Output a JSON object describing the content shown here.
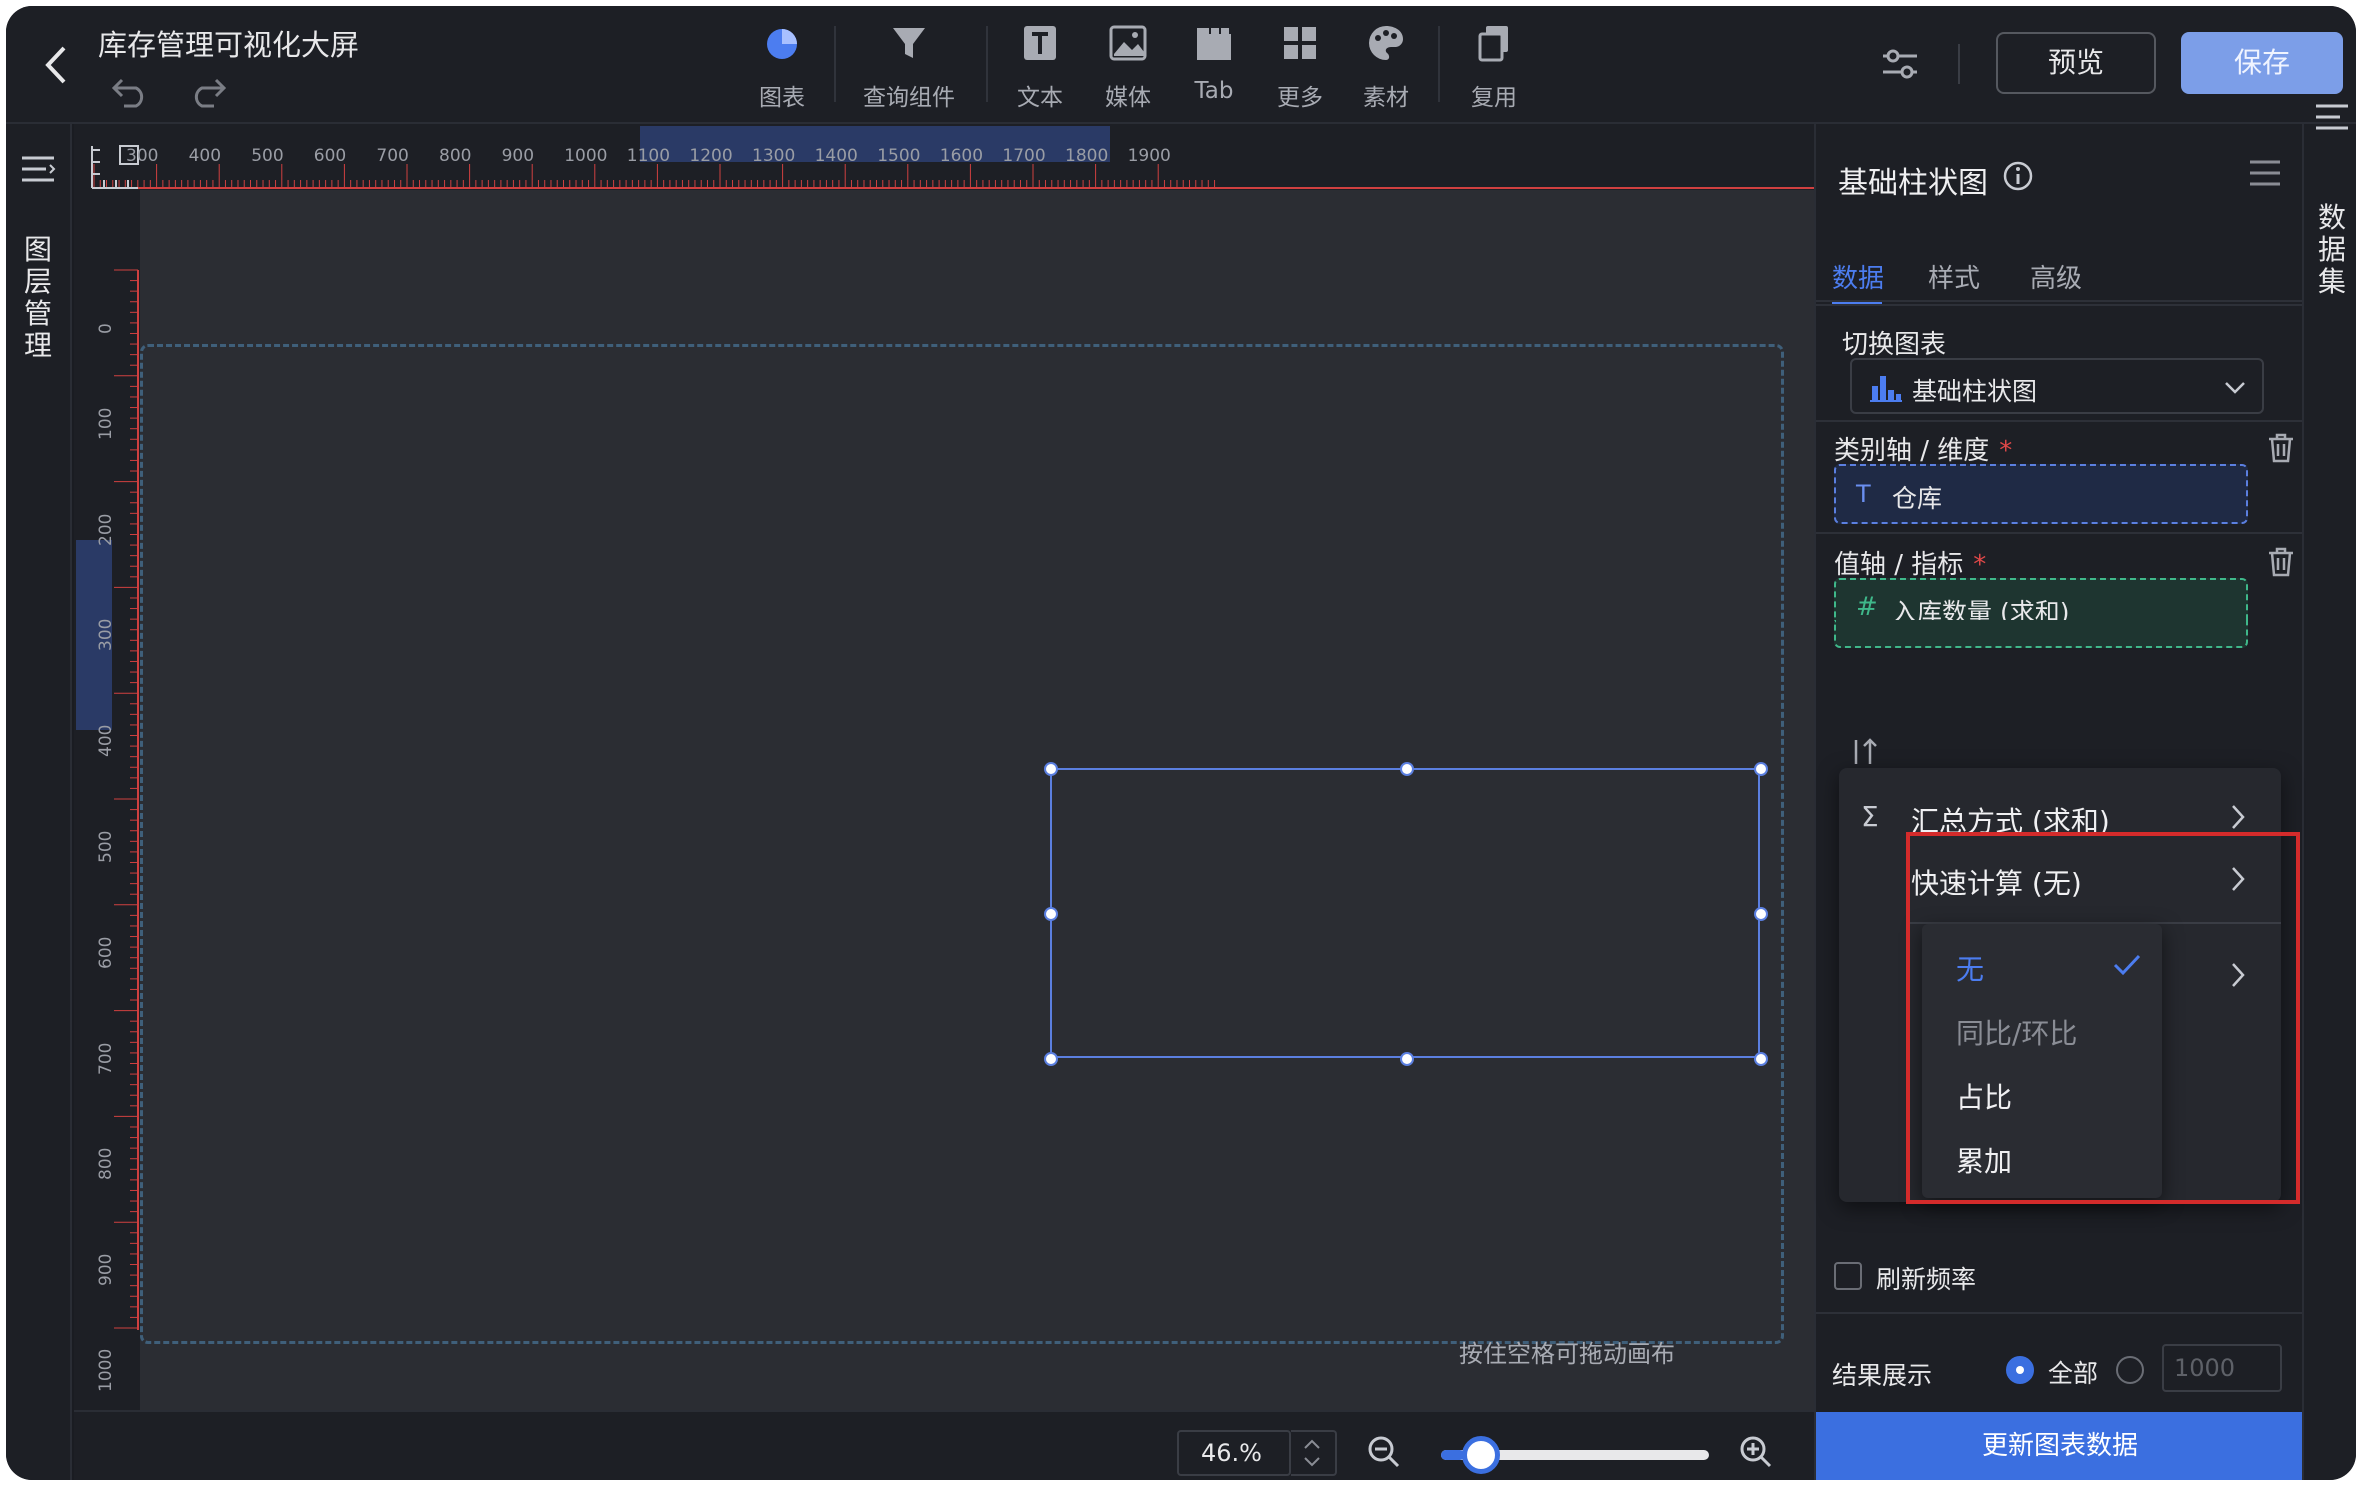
{
  "header": {
    "title": "库存管理可视化大屏",
    "tools": [
      {
        "id": "chart",
        "label": "图表",
        "icon": "pie-chart-icon"
      },
      {
        "id": "query",
        "label": "查询组件",
        "icon": "filter-funnel-icon"
      },
      {
        "id": "text",
        "label": "文本",
        "icon": "text-t-icon"
      },
      {
        "id": "media",
        "label": "媒体",
        "icon": "image-icon"
      },
      {
        "id": "tab",
        "label": "Tab",
        "icon": "tab-folder-icon"
      },
      {
        "id": "more",
        "label": "更多",
        "icon": "grid-icon"
      },
      {
        "id": "assets",
        "label": "素材",
        "icon": "palette-icon"
      },
      {
        "id": "reuse",
        "label": "复用",
        "icon": "copy-icon"
      }
    ],
    "preview_label": "预览",
    "save_label": "保存"
  },
  "left_strip": {
    "layers_label_chars": [
      "图",
      "层",
      "管",
      "理"
    ]
  },
  "canvas": {
    "ruler_top": [
      "300",
      "400",
      "500",
      "600",
      "700",
      "800",
      "900",
      "1000",
      "1100",
      "1200",
      "1300",
      "1400",
      "1500",
      "1600",
      "1700",
      "1800",
      "1900"
    ],
    "ruler_left": [
      "0",
      "100",
      "200",
      "300",
      "400",
      "500",
      "600",
      "700",
      "800",
      "900",
      "1000"
    ],
    "hint": "按住空格可拖动画布"
  },
  "zoom": {
    "value": "46.%",
    "level": 0.09
  },
  "panel": {
    "title": "基础柱状图",
    "tabs": [
      "数据",
      "样式",
      "高级"
    ],
    "active_tab": 0,
    "switch_chart_label": "切换图表",
    "chart_select_value": "基础柱状图",
    "dimension_label": "类别轴 / 维度",
    "dimension_required": "*",
    "dimension_field": "仓库",
    "metric_label": "值轴 / 指标",
    "metric_required": "*",
    "metric_field": "入库数量 (求和)",
    "refresh_label": "刷新频率",
    "result_label": "结果展示",
    "result_all": "全部",
    "result_limit_placeholder": "1000",
    "update_button": "更新图表数据"
  },
  "right_strip": {
    "dataset_label_chars": [
      "数",
      "据",
      "集"
    ]
  },
  "metric_menu": {
    "items": [
      {
        "icon": "Σ",
        "label": "汇总方式 (求和)"
      },
      {
        "icon": "",
        "label": "快速计算 (无)"
      }
    ]
  },
  "quick_calc_menu": {
    "items": [
      "无",
      "同比/环比",
      "占比",
      "累加"
    ],
    "selected": 0
  },
  "colors": {
    "accent": "#4c7df0",
    "save_bg": "#7c9ee8",
    "highlight": "#d42b2b",
    "dim_border": "#5b7fe0",
    "metric_border": "#3fb88a"
  }
}
